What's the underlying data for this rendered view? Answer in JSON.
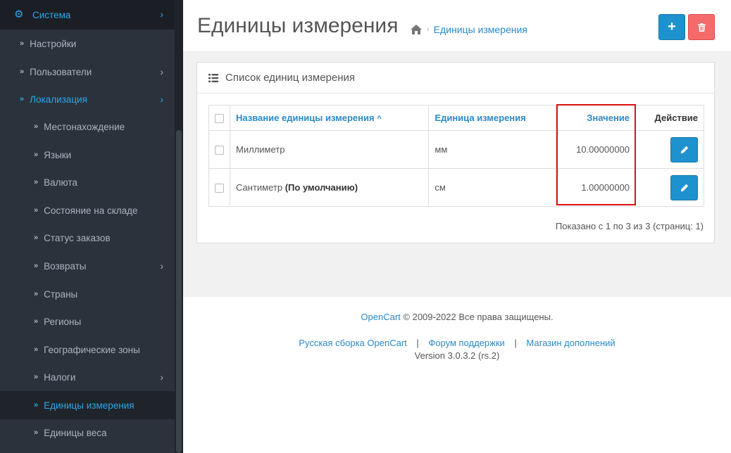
{
  "sidebar": {
    "top_item": {
      "label": "Система",
      "icon": "gear-icon"
    },
    "items": [
      {
        "label": "Настройки"
      },
      {
        "label": "Пользователи"
      },
      {
        "label": "Локализация"
      },
      {
        "label": "Местонахождение"
      },
      {
        "label": "Языки"
      },
      {
        "label": "Валюта"
      },
      {
        "label": "Состояние на складе"
      },
      {
        "label": "Статус заказов"
      },
      {
        "label": "Возвраты"
      },
      {
        "label": "Страны"
      },
      {
        "label": "Регионы"
      },
      {
        "label": "Географические зоны"
      },
      {
        "label": "Налоги"
      },
      {
        "label": "Единицы измерения"
      },
      {
        "label": "Единицы веса"
      }
    ]
  },
  "header": {
    "title": "Единицы измерения",
    "breadcrumb": "Единицы измерения",
    "add_icon": "plus-icon",
    "delete_icon": "trash-icon"
  },
  "panel": {
    "title": "Список единиц измерения",
    "columns": {
      "name": "Название единицы измерения",
      "unit": "Единица измерения",
      "value": "Значение",
      "action": "Действие"
    },
    "rows": [
      {
        "name": "Миллиметр",
        "default_label": "",
        "unit": "мм",
        "value": "10.00000000"
      },
      {
        "name": "Сантиметр",
        "default_label": "(По умолчанию)",
        "unit": "см",
        "value": "1.00000000"
      }
    ],
    "pagination": "Показано с 1 по 3 из 3 (страниц: 1)"
  },
  "footer": {
    "brand": "OpenCart",
    "copyright": " © 2009-2022 Все права защищены.",
    "links": [
      "Русская сборка OpenCart",
      "Форум поддержки",
      "Магазин дополнений"
    ],
    "separator": "|",
    "version": "Version 3.0.3.2 (rs.2)"
  },
  "colors": {
    "accent": "#1e91cf",
    "danger": "#f56b6b",
    "highlight": "#e01010",
    "sidebar_bg": "#2b323c"
  }
}
